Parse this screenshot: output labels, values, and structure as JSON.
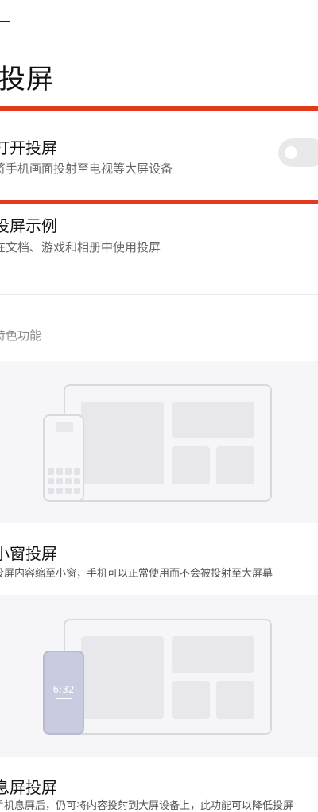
{
  "header": {
    "title": "投屏"
  },
  "settings": {
    "open_cast": {
      "title": "打开投屏",
      "subtitle": "将手机画面投射至电视等大屏设备",
      "enabled": false
    },
    "examples": {
      "title": "投屏示例",
      "subtitle": "在文档、游戏和相册中使用投屏"
    }
  },
  "features": {
    "section_label": "特色功能",
    "items": [
      {
        "title": "小窗投屏",
        "desc": "投屏内容缩至小窗，手机可以正常使用而不会被投射至大屏幕"
      },
      {
        "title": "息屏投屏",
        "desc": "手机息屏后，仍可将内容投射到大屏设备上，此功能可以降低投屏"
      }
    ],
    "phone_clock": "6:32"
  },
  "colors": {
    "accent_red": "#e23a1b",
    "card_bg": "#f6f6f8",
    "phone_purple": "#c9cbe0"
  }
}
